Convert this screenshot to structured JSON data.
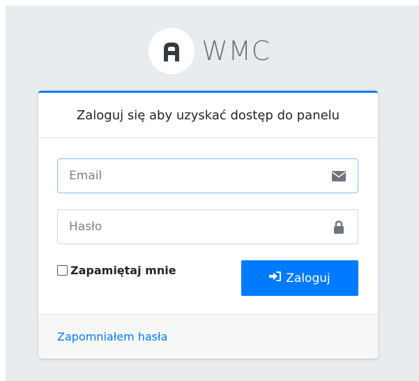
{
  "brand": {
    "name": "WMC",
    "logo_icon": "wmc-logo-icon"
  },
  "card": {
    "header": "Zaloguj się aby uzyskać dostęp do panelu",
    "email": {
      "placeholder": "Email",
      "value": "",
      "icon": "envelope-icon"
    },
    "password": {
      "placeholder": "Hasło",
      "value": "",
      "icon": "lock-icon"
    },
    "remember_label": "Zapamiętaj mnie",
    "remember_checked": false,
    "login_button": {
      "label": "Zaloguj",
      "icon": "sign-in-icon"
    },
    "forgot_link": "Zapomniałem hasła"
  },
  "colors": {
    "accent": "#007bff",
    "background": "#e9ecef",
    "brand_text": "#6c757d"
  }
}
